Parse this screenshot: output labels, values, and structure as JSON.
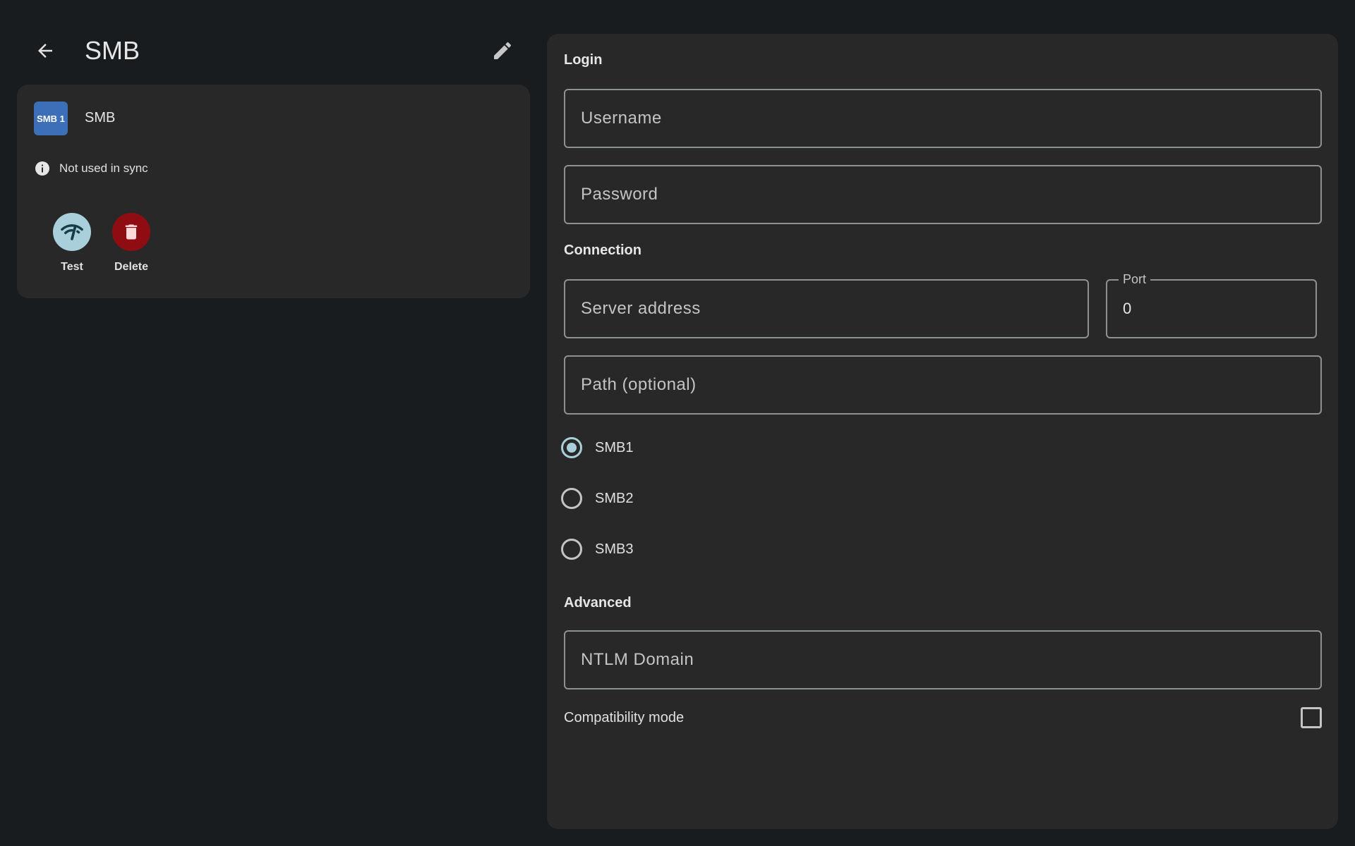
{
  "header": {
    "title": "SMB",
    "back_icon": "arrow-left-icon",
    "edit_icon": "pencil-icon"
  },
  "server_card": {
    "badge_text": "SMB 1",
    "badge_color": "#3d6eb8",
    "name": "SMB",
    "sync_status": "Not used in sync",
    "actions": {
      "test_label": "Test",
      "delete_label": "Delete"
    }
  },
  "form": {
    "login_section": "Login",
    "username_placeholder": "Username",
    "password_placeholder": "Password",
    "connection_section": "Connection",
    "server_address_placeholder": "Server address",
    "port_label": "Port",
    "port_value": "0",
    "path_placeholder": "Path (optional)",
    "protocol_options": [
      {
        "label": "SMB1",
        "selected": true
      },
      {
        "label": "SMB2",
        "selected": false
      },
      {
        "label": "SMB3",
        "selected": false
      }
    ],
    "advanced_section": "Advanced",
    "ntlm_domain_placeholder": "NTLM Domain",
    "compatibility_mode_label": "Compatibility mode",
    "compatibility_mode_checked": false
  },
  "colors": {
    "background": "#191c1f",
    "card": "#282828",
    "accent": "#a9cfdb",
    "danger": "#8f0d12"
  }
}
